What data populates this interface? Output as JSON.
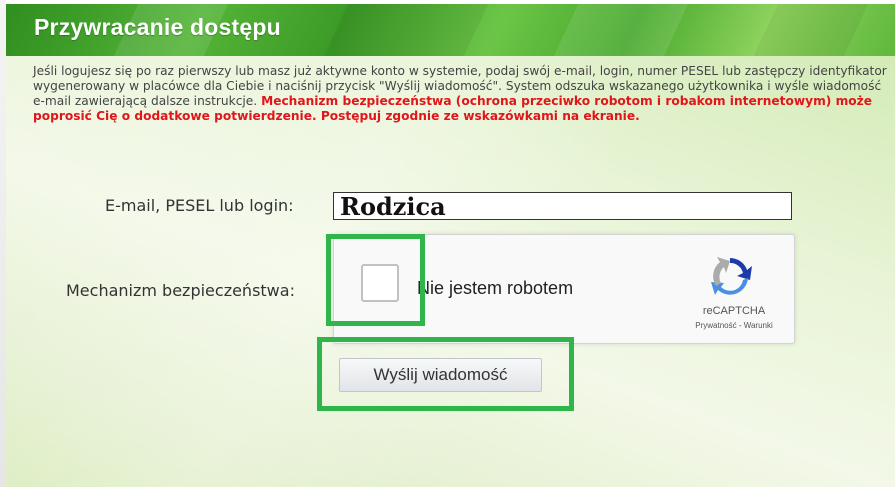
{
  "form": {
    "title": "Przywracanie dostępu",
    "description": "Jeśli logujesz się po raz pierwszy lub masz już aktywne konto w systemie, podaj swój e-mail, login, numer PESEL lub zastępczy identyfikator wygenerowany w placówce dla Ciebie i naciśnij przycisk \"Wyślij wiadomość\". System odszuka wskazanego użytkownika i wyśle wiadomość e-mail zawierającą dalsze instrukcje.",
    "warning": "Mechanizm bezpieczeństwa (ochrona przeciwko robotom i robakom internetowym) może poprosić Cię o dodatkowe potwierdzenie. Postępuj zgodnie ze wskazówkami na ekranie.",
    "login_label": "E-mail, PESEL lub login:",
    "login_value": "Rodzica",
    "security_label": "Mechanizm bezpieczeństwa:",
    "send_button": "Wyślij wiadomość"
  },
  "captcha": {
    "checkbox_label": "Nie jestem robotem",
    "brand": "reCAPTCHA",
    "links": "Prywatność - Warunki",
    "icon": "recaptcha-logo-icon"
  },
  "colors": {
    "header_green": "#4aa82e",
    "warning_red": "#e0161b",
    "highlight_green": "#2fb64a"
  }
}
